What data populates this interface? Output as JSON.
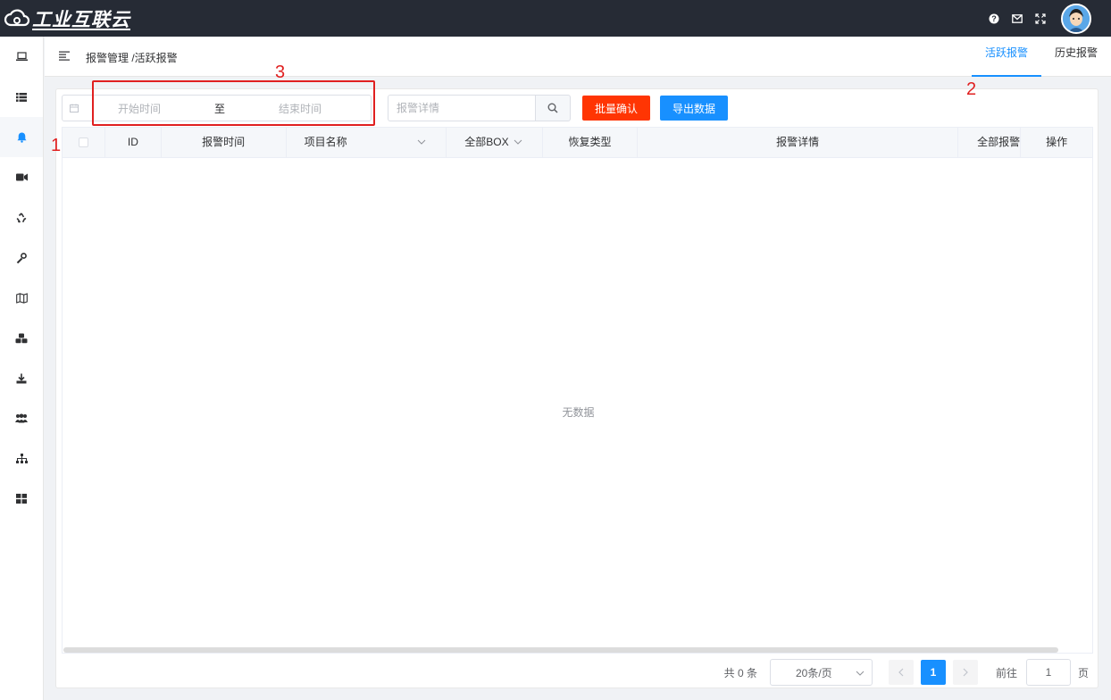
{
  "app": {
    "logo_text": "工业互联云"
  },
  "breadcrumb": {
    "text": "报警管理 /活跃报警"
  },
  "tabs": [
    {
      "label": "活跃报警"
    },
    {
      "label": "历史报警"
    }
  ],
  "filters": {
    "start_placeholder": "开始时间",
    "range_separator": "至",
    "end_placeholder": "结束时间",
    "search_placeholder": "报警详情"
  },
  "buttons": {
    "batch_confirm": "批量确认",
    "export": "导出数据"
  },
  "table": {
    "columns": [
      "ID",
      "报警时间",
      "项目名称",
      "全部BOX",
      "恢复类型",
      "报警详情",
      "全部报警",
      "操作"
    ],
    "empty_text": "无数据"
  },
  "pagination": {
    "total": "共 0 条",
    "page_size": "20条/页",
    "current_page": "1",
    "goto_label": "前往",
    "goto_value": "1",
    "page_unit": "页"
  },
  "annotations": [
    "1",
    "2",
    "3"
  ],
  "colors": {
    "primary": "#1890ff",
    "danger": "#ff3503",
    "topbar": "#262b35",
    "annotation": "#e02020"
  }
}
